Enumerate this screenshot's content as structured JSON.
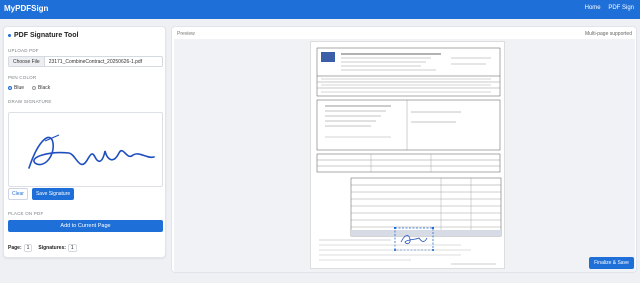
{
  "app": {
    "brand": "MyPDFSign",
    "nav": [
      "Home",
      "PDF Sign"
    ]
  },
  "panel": {
    "title": "PDF Signature Tool",
    "upload_label": "UPLOAD PDF",
    "choose_file": "Choose File",
    "file_name": "23171_CombineContract_20250626-1.pdf",
    "pen_label": "PEN COLOR",
    "pen_options": [
      "Blue",
      "Black"
    ],
    "pen_selected": "Blue",
    "draw_label": "DRAW SIGNATURE",
    "clear": "Clear",
    "save_signature": "Save Signature",
    "place_label": "PLACE ON PDF",
    "add_current": "Add to Current Page",
    "page_label": "Page:",
    "page_value": "1",
    "sig_label": "Signatures:",
    "sig_value": "1"
  },
  "preview": {
    "label": "Preview",
    "multipage": "Multi-page supported"
  },
  "finalize": "Finalize & Save",
  "colors": {
    "accent": "#1f6fd8"
  }
}
